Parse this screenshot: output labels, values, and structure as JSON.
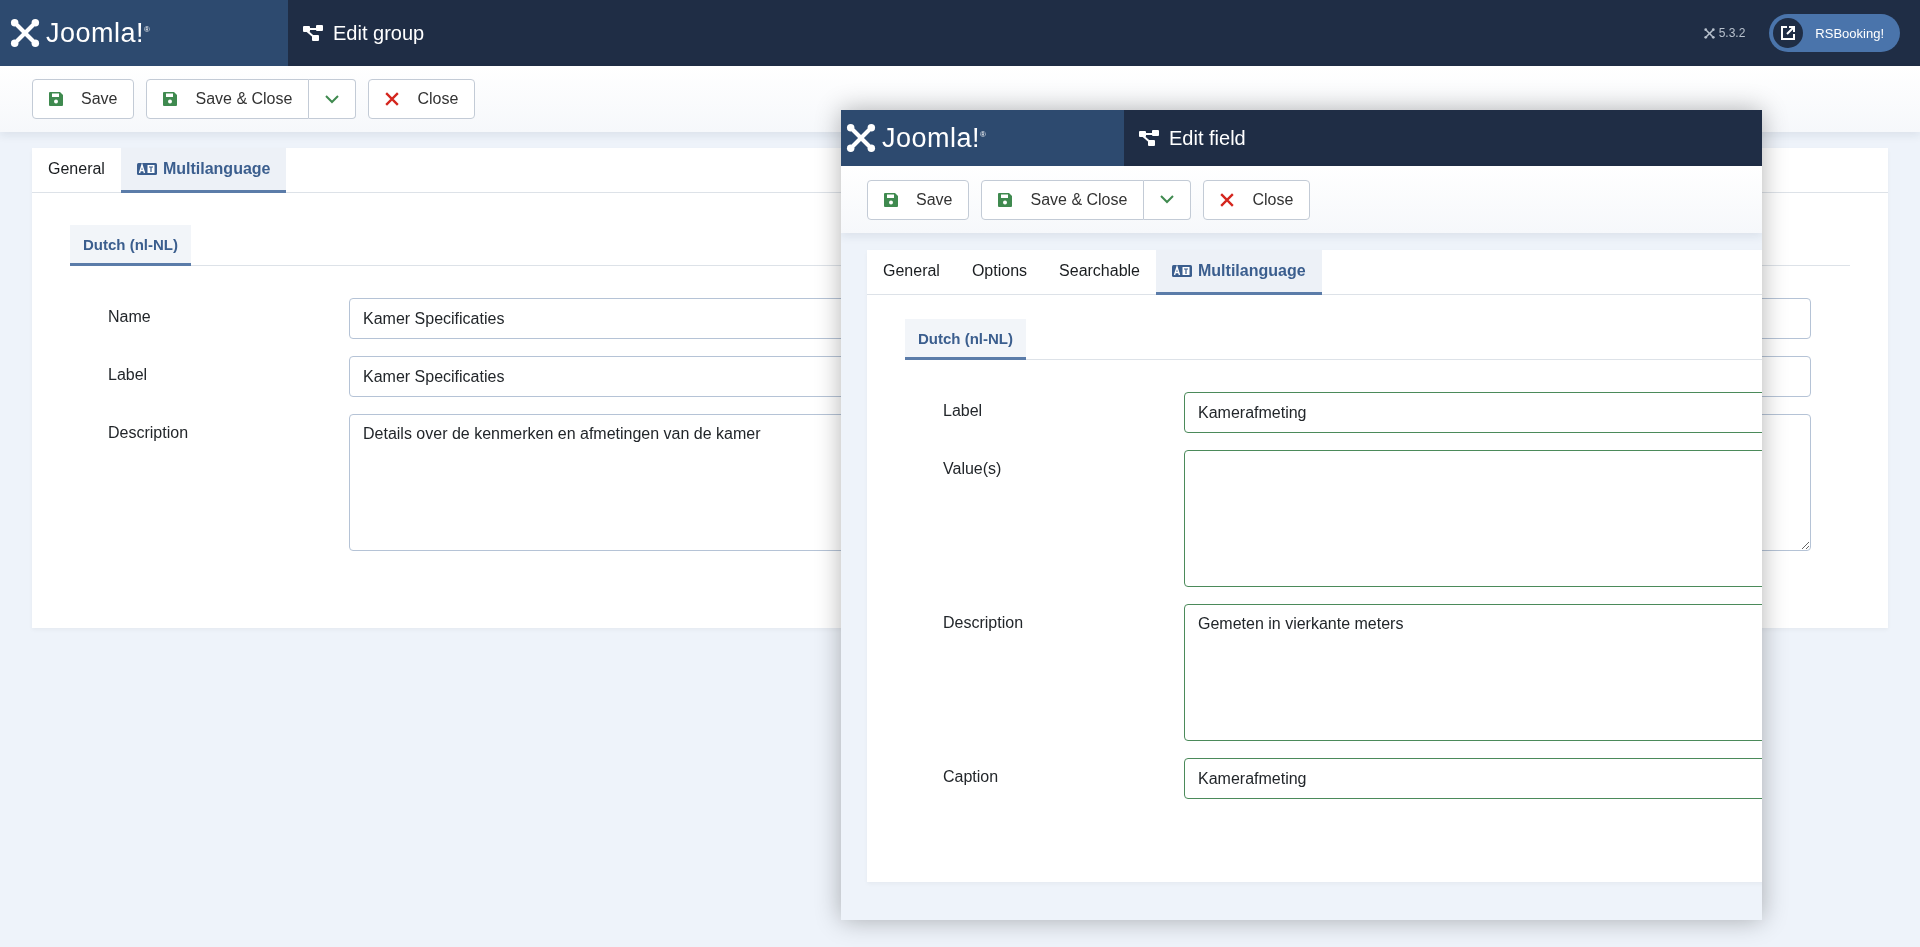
{
  "header": {
    "brand": "Joomla!$^{®}$",
    "title": "Edit group",
    "version": "5.3.2",
    "site_button": "RSBooking!"
  },
  "toolbar": [
    {
      "label": "Save",
      "kind": "save"
    },
    {
      "label": "Save & Close",
      "kind": "save-split"
    },
    {
      "label": "Close",
      "kind": "close"
    }
  ],
  "tabs": [
    {
      "label": "General",
      "selected": false,
      "kind": "plain"
    },
    {
      "label": "Multilanguage",
      "selected": true,
      "kind": "language"
    }
  ],
  "language_tabs": [
    {
      "label": "Dutch (nl-NL)",
      "selected": true
    }
  ],
  "fields": [
    {
      "label": "Name",
      "kind": "input",
      "value": "Kamer Specificaties",
      "valid": false
    },
    {
      "label": "Label",
      "kind": "input",
      "value": "Kamer Specificaties",
      "valid": false
    },
    {
      "label": "Description",
      "kind": "textarea",
      "value": "Details over de kenmerken en afmetingen van de kamer",
      "valid": false
    }
  ],
  "modal": {
    "brand": "Joomla!$^{®}$",
    "title": "Edit field",
    "toolbar": [
      {
        "label": "Save",
        "kind": "save"
      },
      {
        "label": "Save & Close",
        "kind": "save-split"
      },
      {
        "label": "Close",
        "kind": "close"
      }
    ],
    "tabs": [
      {
        "label": "General",
        "selected": false,
        "kind": "plain"
      },
      {
        "label": "Options",
        "selected": false,
        "kind": "plain"
      },
      {
        "label": "Searchable",
        "selected": false,
        "kind": "plain"
      },
      {
        "label": "Multilanguage",
        "selected": true,
        "kind": "language"
      }
    ],
    "language_tabs": [
      {
        "label": "Dutch (nl-NL)",
        "selected": true
      }
    ],
    "fields": [
      {
        "label": "Label",
        "kind": "input",
        "value": "Kamerafmeting",
        "valid": true
      },
      {
        "label": "Value(s)",
        "kind": "textarea",
        "valid": true
      },
      {
        "label": "Description",
        "kind": "textarea",
        "value": "Gemeten in vierkante meters",
        "valid": true
      },
      {
        "label": "Caption",
        "kind": "input",
        "value": "Kamerafmeting",
        "valid": true
      }
    ]
  }
}
